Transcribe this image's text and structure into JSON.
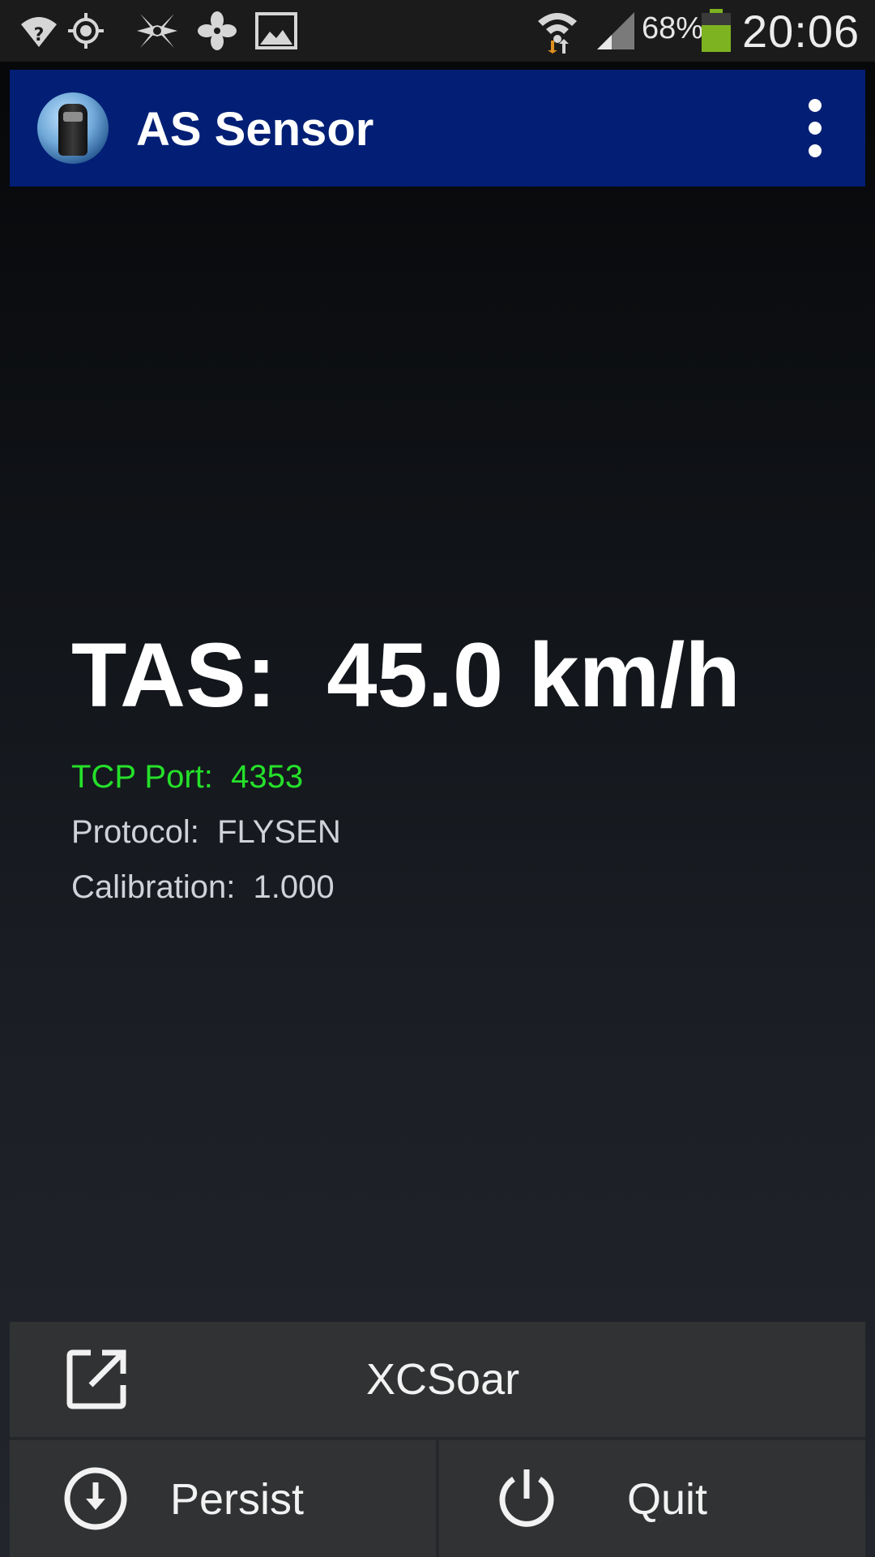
{
  "status_bar": {
    "icons": [
      "wifi-question-icon",
      "gps-icon",
      "app-shuriken-icon",
      "fan-icon",
      "image-icon",
      "wifi-signal-icon",
      "cell-signal-icon",
      "battery-icon"
    ],
    "battery": "68%",
    "time": "20:06"
  },
  "app_bar": {
    "title": "AS Sensor",
    "menu_icon": "overflow-menu-icon"
  },
  "content": {
    "tas": "TAS:  45.0 km/h",
    "tcp_port": "TCP Port:  4353",
    "protocol": "Protocol:  FLYSEN",
    "calibration": "Calibration:  1.000"
  },
  "buttons": {
    "xcsoar": "XCSoar",
    "persist": "Persist",
    "quit": "Quit"
  },
  "colors": {
    "app_bar": "#021f75",
    "tcp_text": "#25e02a",
    "button_bg": "#313233",
    "battery_fill": "#7db321"
  }
}
